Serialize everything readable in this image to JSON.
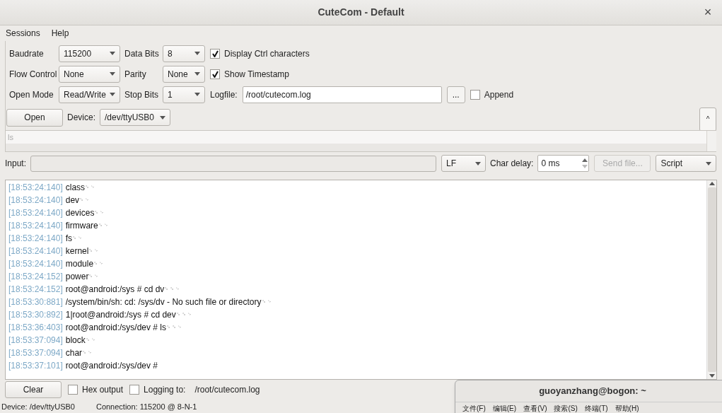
{
  "window": {
    "title": "CuteCom - Default",
    "close": "×"
  },
  "menu": [
    "Sessions",
    "Help"
  ],
  "settings": {
    "rows": [
      {
        "label": "Baudrate",
        "value": "115200",
        "label2": "Data Bits",
        "value2": "8",
        "check": {
          "label": "Display Ctrl characters",
          "checked": true
        }
      },
      {
        "label": "Flow Control",
        "value": "None",
        "label2": "Parity",
        "value2": "None",
        "check": {
          "label": "Show Timestamp",
          "checked": true
        }
      },
      {
        "label": "Open Mode",
        "value": "Read/Write",
        "label2": "Stop Bits",
        "value2": "1",
        "logfile": {
          "label": "Logfile:",
          "value": "/root/cutecom.log",
          "browse": "...",
          "append": {
            "label": "Append",
            "checked": false
          }
        }
      }
    ],
    "open": "Open",
    "device_label": "Device:",
    "device": "/dev/ttyUSB0",
    "collapse": "^",
    "history": [
      "ls"
    ]
  },
  "input": {
    "label": "Input:",
    "line_end": "LF",
    "char_delay_label": "Char delay:",
    "char_delay": "0 ms",
    "send_file": "Send file...",
    "send_file_disabled": true,
    "script": "Script"
  },
  "output": [
    {
      "time": "[18:53:24:140]",
      "text": "class",
      "ctrl": "␍␊"
    },
    {
      "time": "[18:53:24:140]",
      "text": "dev",
      "ctrl": "␍␊"
    },
    {
      "time": "[18:53:24:140]",
      "text": "devices",
      "ctrl": "␍␊"
    },
    {
      "time": "[18:53:24:140]",
      "text": "firmware",
      "ctrl": "␍␊"
    },
    {
      "time": "[18:53:24:140]",
      "text": "fs",
      "ctrl": "␍␊"
    },
    {
      "time": "[18:53:24:140]",
      "text": "kernel",
      "ctrl": "␍␊"
    },
    {
      "time": "[18:53:24:140]",
      "text": "module",
      "ctrl": "␍␊"
    },
    {
      "time": "[18:53:24:152]",
      "text": "power",
      "ctrl": "␍␊"
    },
    {
      "time": "[18:53:24:152]",
      "text": "root@android:/sys # cd dv",
      "ctrl": "␍␍␊"
    },
    {
      "time": "[18:53:30:881]",
      "text": "/system/bin/sh: cd: /sys/dv - No such file or directory",
      "ctrl": "␍␊"
    },
    {
      "time": "[18:53:30:892]",
      "text": "1|root@android:/sys # cd dev",
      "ctrl": "␍␍␊"
    },
    {
      "time": "[18:53:36:403]",
      "text": "root@android:/sys/dev # ls",
      "ctrl": "␍␍␊"
    },
    {
      "time": "[18:53:37:094]",
      "text": "block",
      "ctrl": "␍␊"
    },
    {
      "time": "[18:53:37:094]",
      "text": "char",
      "ctrl": "␍␊"
    },
    {
      "time": "[18:53:37:101]",
      "text": "root@android:/sys/dev #"
    }
  ],
  "bottom": {
    "clear": "Clear",
    "hex": {
      "label": "Hex output",
      "checked": false
    },
    "logging": {
      "label": "Logging to:",
      "checked": false
    },
    "log_path": "/root/cutecom.log"
  },
  "status_bar": {
    "device": "Device:  /dev/ttyUSB0",
    "connection": "Connection:  115200 @ 8-N-1"
  },
  "terminal": {
    "title": "guoyanzhang@bogon: ~",
    "menu": [
      "文件(F)",
      "编辑(E)",
      "查看(V)",
      "搜索(S)",
      "终端(T)",
      "帮助(H)"
    ]
  }
}
